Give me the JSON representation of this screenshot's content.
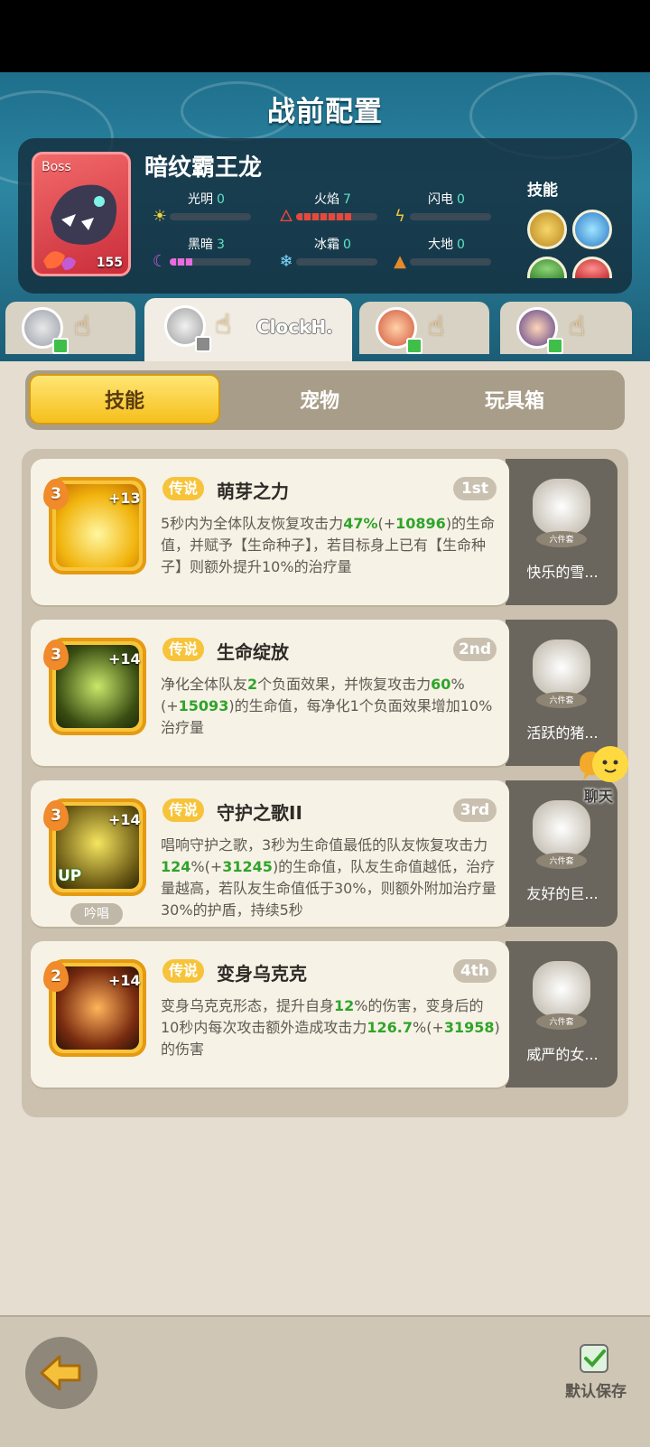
{
  "header": {
    "title": "战前配置"
  },
  "boss": {
    "tag": "Boss",
    "name": "暗纹霸王龙",
    "level": "155",
    "elements": [
      {
        "label": "光明",
        "value": "0",
        "icon": "sun-icon",
        "fill": 0
      },
      {
        "label": "火焰",
        "value": "7",
        "icon": "fire-icon",
        "fill": 0.7
      },
      {
        "label": "闪电",
        "value": "0",
        "icon": "lightning-icon",
        "fill": 0
      },
      {
        "label": "黑暗",
        "value": "3",
        "icon": "moon-icon",
        "fill": 0.3
      },
      {
        "label": "冰霜",
        "value": "0",
        "icon": "snowflake-icon",
        "fill": 0
      },
      {
        "label": "大地",
        "value": "0",
        "icon": "mountain-icon",
        "fill": 0
      }
    ],
    "skills_label": "技能"
  },
  "heroes": [
    {
      "name": "",
      "active": false
    },
    {
      "name": "ClockH.",
      "active": true
    },
    {
      "name": "",
      "active": false
    },
    {
      "name": "",
      "active": false
    }
  ],
  "tabs": [
    {
      "label": "技能",
      "active": true
    },
    {
      "label": "宠物",
      "active": false
    },
    {
      "label": "玩具箱",
      "active": false
    }
  ],
  "skills": [
    {
      "rarity": "传说",
      "title": "萌芽之力",
      "order": "1st",
      "level": "3",
      "plus": "+13",
      "desc_parts": [
        [
          "5秒内为全体队友恢复攻击力",
          false
        ],
        [
          "47%",
          true
        ],
        [
          "(+",
          false
        ],
        [
          "10896",
          true
        ],
        [
          ")的生命值，并赋予【生命种子】，若目标身上已有【生命种子】则额外提升10%的治疗量",
          false
        ]
      ],
      "pet": {
        "name": "快乐的雪...",
        "set": "六件套"
      }
    },
    {
      "rarity": "传说",
      "title": "生命绽放",
      "order": "2nd",
      "level": "3",
      "plus": "+14",
      "desc_parts": [
        [
          "净化全体队友",
          false
        ],
        [
          "2",
          true
        ],
        [
          "个负面效果，并恢复攻击力",
          false
        ],
        [
          "60",
          true
        ],
        [
          "%(+",
          false
        ],
        [
          "15093",
          true
        ],
        [
          ")的生命值，每净化1个负面效果增加10%治疗量",
          false
        ]
      ],
      "pet": {
        "name": "活跃的猪...",
        "set": "六件套"
      }
    },
    {
      "rarity": "传说",
      "title": "守护之歌II",
      "order": "3rd",
      "level": "3",
      "plus": "+14",
      "badge": "UP",
      "chant": "吟唱",
      "desc_parts": [
        [
          "唱响守护之歌，3秒为生命值最低的队友恢复攻击力",
          false
        ],
        [
          "124",
          true
        ],
        [
          "%(+",
          false
        ],
        [
          "31245",
          true
        ],
        [
          ")的生命值，队友生命值越低，治疗量越高，若队友生命值低于30%，则额外附加治疗量30%的护盾，持续5秒",
          false
        ]
      ],
      "pet": {
        "name": "友好的巨...",
        "set": "六件套"
      }
    },
    {
      "rarity": "传说",
      "title": "变身乌克克",
      "order": "4th",
      "level": "2",
      "plus": "+14",
      "desc_parts": [
        [
          "变身乌克克形态，提升自身",
          false
        ],
        [
          "12",
          true
        ],
        [
          "%的伤害，变身后的10秒内每次攻击额外造成攻击力",
          false
        ],
        [
          "126.7",
          true
        ],
        [
          "%(+",
          false
        ],
        [
          "31958",
          true
        ],
        [
          ")的伤害",
          false
        ]
      ],
      "pet": {
        "name": "威严的女...",
        "set": "六件套"
      }
    }
  ],
  "chat": {
    "label": "聊天"
  },
  "footer": {
    "save_label": "默认保存"
  }
}
